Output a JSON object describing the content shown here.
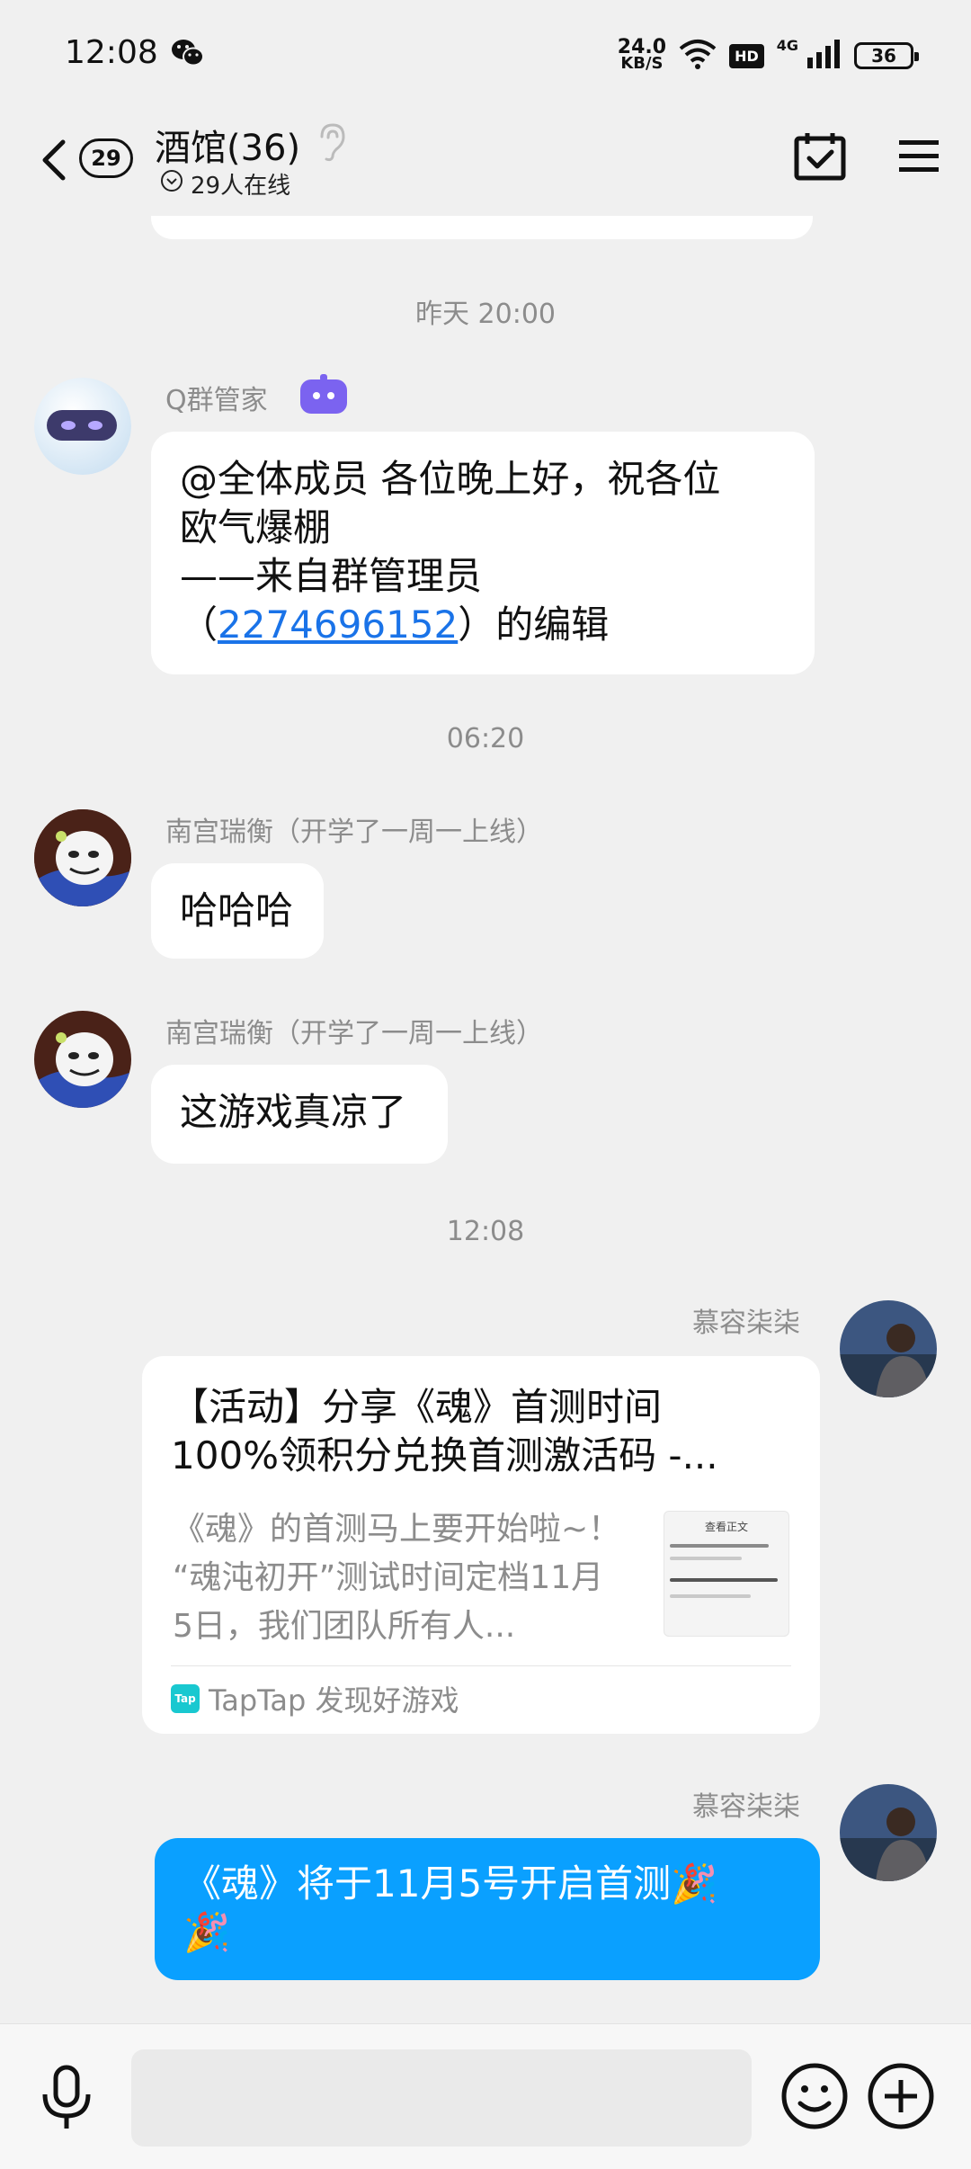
{
  "status_bar": {
    "time": "12:08",
    "speed_value": "24.0",
    "speed_unit": "KB/S",
    "hd": "HD",
    "network": "4G",
    "battery": "36"
  },
  "header": {
    "unread_count": "29",
    "title": "酒馆(36)",
    "online_text": "29人在线"
  },
  "messages": {
    "ts1": "昨天 20:00",
    "bot": {
      "sender": "Q群管家",
      "line1": "@全体成员 各位晚上好，祝各位",
      "line2": "欧气爆棚",
      "line3": "——来自群管理员",
      "line4_pre": "（",
      "line4_link": "2274696152",
      "line4_post": "）的编辑"
    },
    "ts2": "06:20",
    "m1": {
      "sender": "南宫瑞衡（开学了一周一上线）",
      "text": "哈哈哈"
    },
    "m2": {
      "sender": "南宫瑞衡（开学了一周一上线）",
      "text": "这游戏真凉了"
    },
    "ts3": "12:08",
    "card": {
      "sender": "慕容柒柒",
      "title_line1": "【活动】分享《魂》首测时间",
      "title_line2": "100%领积分兑换首测激活码 -...",
      "desc_line1": "《魂》的首测马上要开始啦~！",
      "desc_line2": "“魂沌初开”测试时间定档11月",
      "desc_line3": "5日，我们团队所有人...",
      "thumb_title": "查看正文",
      "source": "TapTap 发现好游戏",
      "source_logo": "Tap"
    },
    "self_msg": {
      "sender": "慕容柒柒",
      "line1": "《魂》将于11月5号开启首测🎉",
      "line2": "🎉"
    }
  },
  "input": {
    "value": ""
  }
}
